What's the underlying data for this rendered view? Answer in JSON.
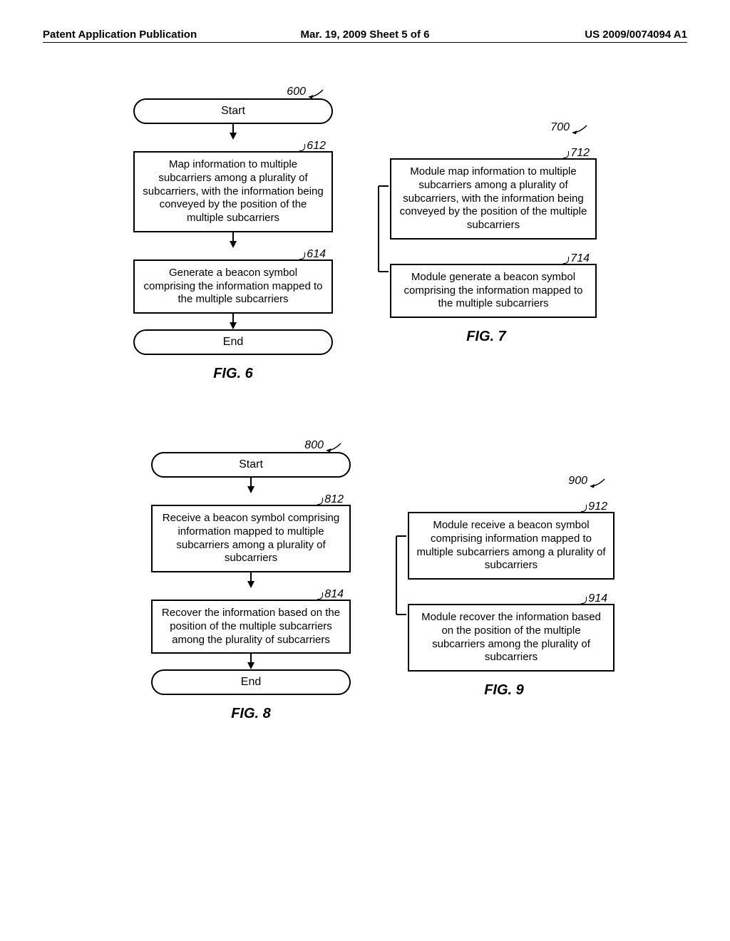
{
  "header": {
    "left": "Patent Application Publication",
    "mid": "Mar. 19, 2009  Sheet 5 of 6",
    "right": "US 2009/0074094 A1"
  },
  "fig6": {
    "ref": "600",
    "start": "Start",
    "step612_num": "612",
    "step612": "Map information to multiple subcarriers among a plurality of subcarriers, with the information being conveyed by the position of the multiple subcarriers",
    "step614_num": "614",
    "step614": "Generate a beacon symbol comprising the information mapped to the multiple subcarriers",
    "end": "End",
    "caption": "FIG. 6"
  },
  "fig7": {
    "ref": "700",
    "step712_num": "712",
    "step712": "Module map information to multiple subcarriers among a plurality of subcarriers, with the information being conveyed by the position of the multiple subcarriers",
    "step714_num": "714",
    "step714": "Module generate a beacon symbol comprising the information mapped to the multiple subcarriers",
    "caption": "FIG. 7"
  },
  "fig8": {
    "ref": "800",
    "start": "Start",
    "step812_num": "812",
    "step812": "Receive a beacon symbol comprising information mapped to multiple subcarriers among a plurality of subcarriers",
    "step814_num": "814",
    "step814": "Recover the information based on the position of the multiple subcarriers among the plurality of subcarriers",
    "end": "End",
    "caption": "FIG. 8"
  },
  "fig9": {
    "ref": "900",
    "step912_num": "912",
    "step912": "Module receive a beacon symbol comprising information mapped to multiple subcarriers among a plurality of subcarriers",
    "step914_num": "914",
    "step914": "Module recover the information based on the position of the multiple subcarriers among the plurality of subcarriers",
    "caption": "FIG. 9"
  }
}
